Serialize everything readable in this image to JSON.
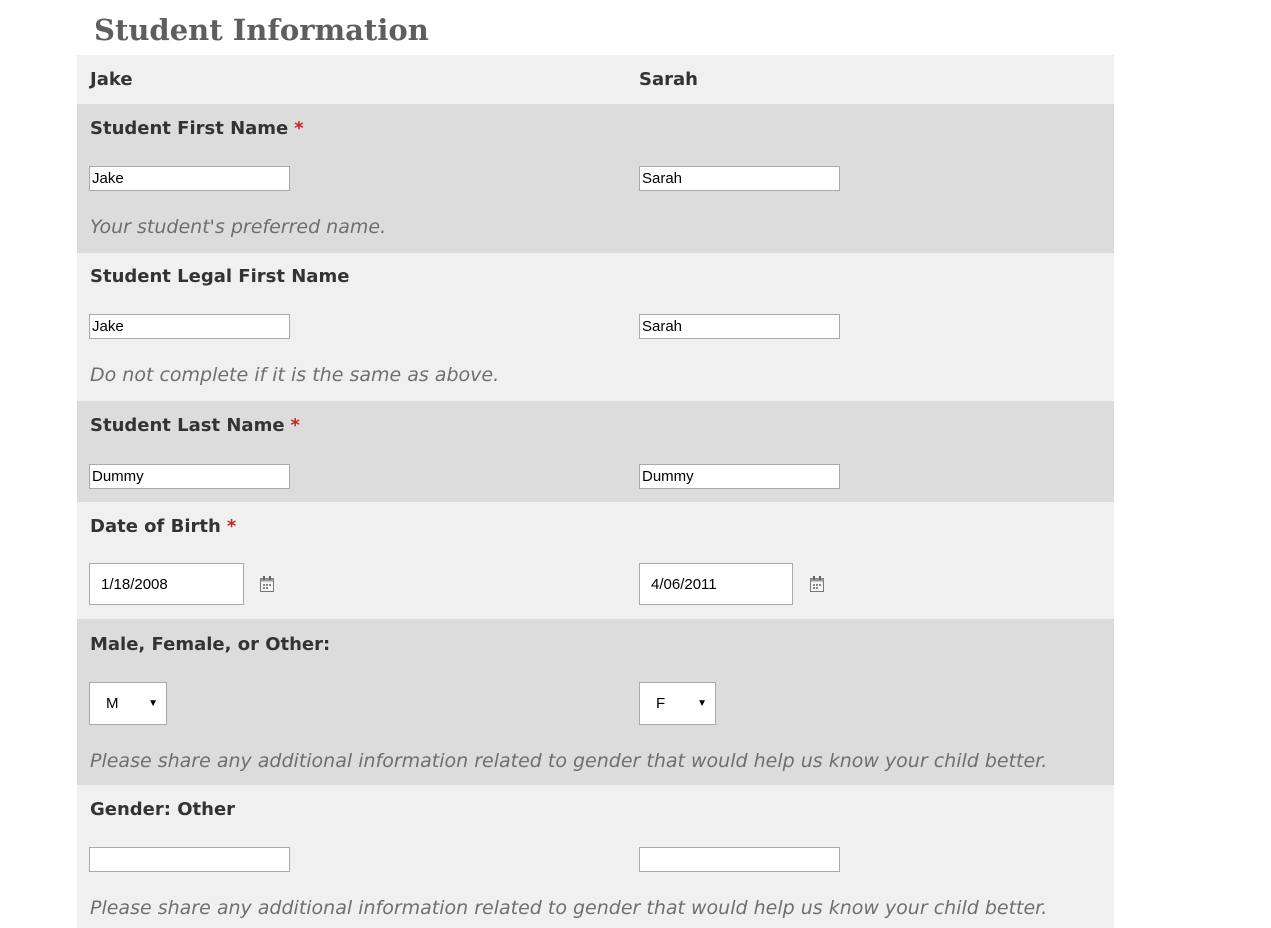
{
  "page": {
    "title": "Student Information"
  },
  "students": [
    {
      "name": "Jake"
    },
    {
      "name": "Sarah"
    }
  ],
  "required_marker": "*",
  "icons": {
    "calendar": "calendar-icon",
    "dropdown": "chevron-down-icon"
  },
  "colors": {
    "title": "#5e5e5e",
    "row_light": "#f0f0f0",
    "row_dark": "#dcdcdc",
    "required": "#cc2222",
    "help_text": "#6f6f6f"
  },
  "fields": {
    "first_name": {
      "label": "Student First Name",
      "required": true,
      "values": [
        "Jake",
        "Sarah"
      ],
      "help": "Your student's preferred name."
    },
    "legal_first_name": {
      "label": "Student Legal First Name",
      "required": false,
      "values": [
        "Jake",
        "Sarah"
      ],
      "help": "Do not complete if it is the same as above."
    },
    "last_name": {
      "label": "Student Last Name",
      "required": true,
      "values": [
        "Dummy",
        "Dummy"
      ]
    },
    "dob": {
      "label": "Date of Birth",
      "required": true,
      "values": [
        "1/18/2008",
        "4/06/2011"
      ]
    },
    "gender": {
      "label": "Male, Female, or Other:",
      "selected": [
        "M",
        "F"
      ],
      "help": "Please share any additional information related to gender that would help us know your child better."
    },
    "gender_other": {
      "label": "Gender: Other",
      "values": [
        "",
        ""
      ],
      "help": "Please share any additional information related to gender that would help us know your child better."
    }
  }
}
